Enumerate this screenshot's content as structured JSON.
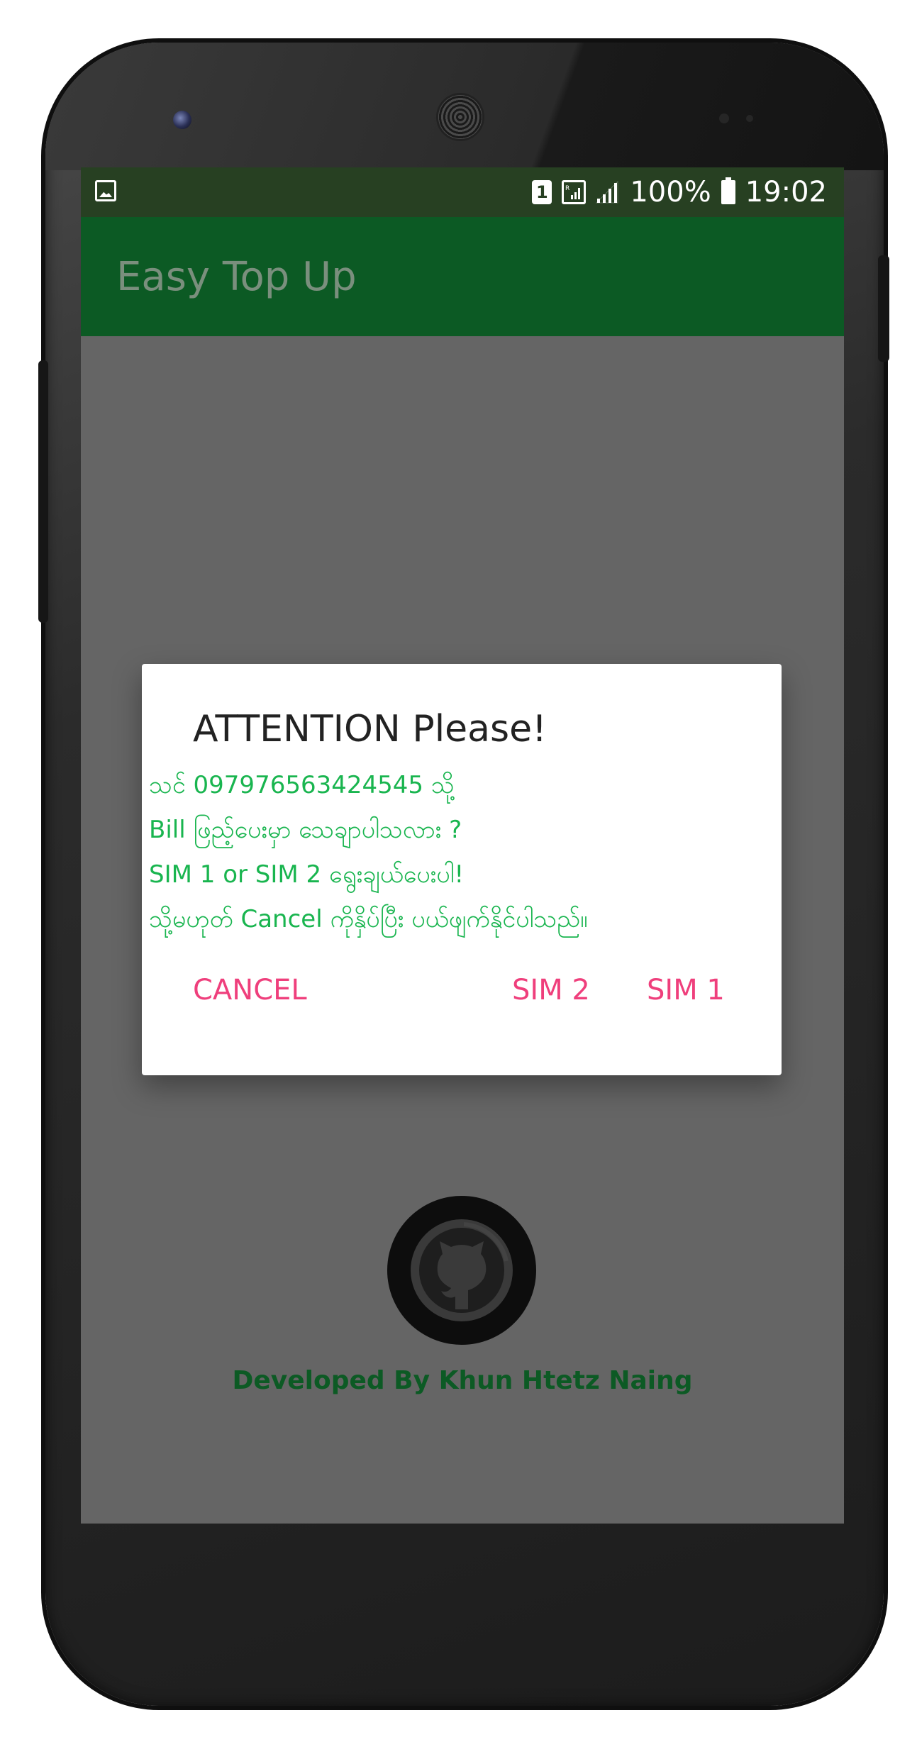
{
  "status_bar": {
    "sim_slot": "1",
    "battery_percent": "100%",
    "time": "19:02"
  },
  "app_bar": {
    "title": "Easy Top Up"
  },
  "dialog": {
    "title": "ATTENTION Please!",
    "message_lines": [
      "သင် 097976563424545 သို့",
      "Bill ဖြည့်ပေးမှာ သေချာပါသလား ?",
      "SIM 1 or SIM 2 ရွေးချယ်ပေးပါ!",
      "သို့မဟုတ် Cancel ကိုနှိပ်ပြီး ပယ်ဖျက်နိုင်ပါသည်။"
    ],
    "buttons": {
      "cancel": "CANCEL",
      "sim2": "SIM 2",
      "sim1": "SIM 1"
    }
  },
  "footer": {
    "credit": "Developed By Khun Htetz Naing",
    "logo_icon": "github-octocat-icon"
  },
  "colors": {
    "status_bar": "#274022",
    "app_bar": "#0c5a24",
    "dim_background": "#656565",
    "message_text": "#19b54f",
    "button_text": "#ef3f7c"
  }
}
